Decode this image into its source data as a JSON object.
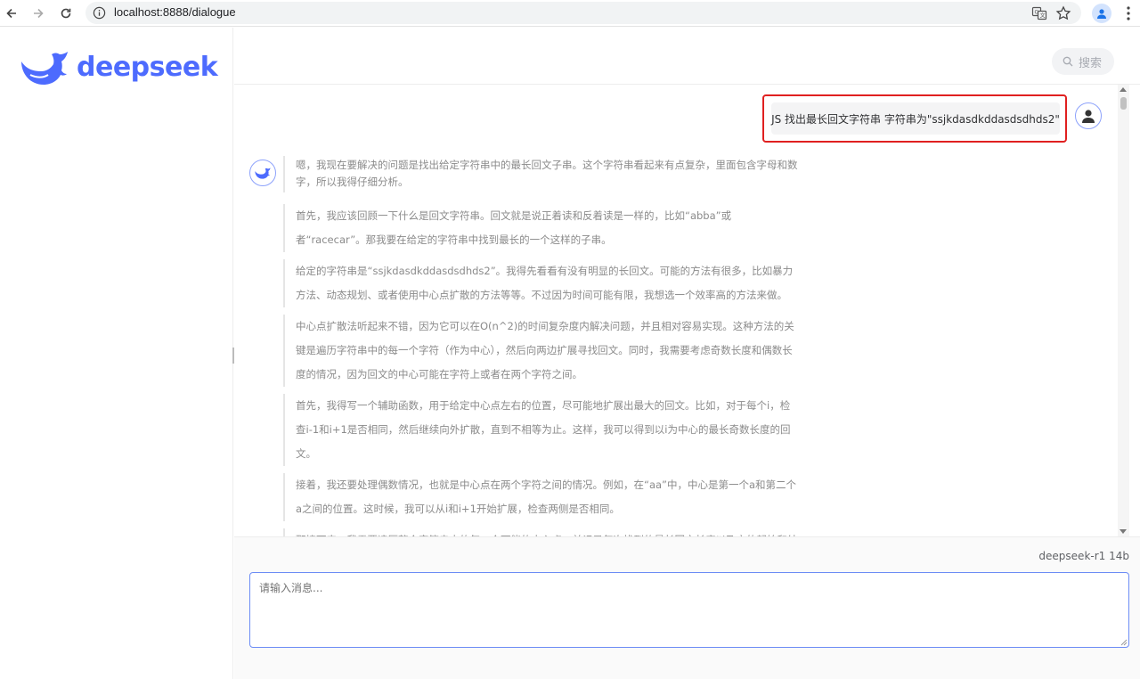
{
  "browser": {
    "url": "localhost:8888/dialogue"
  },
  "sidebar": {
    "logo_text": "deepseek"
  },
  "header": {
    "search_placeholder": "搜索"
  },
  "chat": {
    "user_message": "JS 找出最长回文字符串 字符串为\"ssjkdasdkddasdsdhds2\"",
    "thinking": [
      "嗯，我现在要解决的问题是找出给定字符串中的最长回文子串。这个字符串看起来有点复杂，里面包含字母和数字，所以我得仔细分析。",
      "首先，我应该回顾一下什么是回文字符串。回文就是说正着读和反着读是一样的，比如“abba”或者“racecar”。那我要在给定的字符串中找到最长的一个这样的子串。",
      "给定的字符串是“ssjkdasdkddasdsdhds2”。我得先看看有没有明显的长回文。可能的方法有很多，比如暴力方法、动态规划、或者使用中心点扩散的方法等等。不过因为时间可能有限，我想选一个效率高的方法来做。",
      "中心点扩散法听起来不错，因为它可以在O(n^2)的时间复杂度内解决问题，并且相对容易实现。这种方法的关键是遍历字符串中的每一个字符（作为中心），然后向两边扩展寻找回文。同时，我需要考虑奇数长度和偶数长度的情况，因为回文的中心可能在字符上或者在两个字符之间。",
      "首先，我得写一个辅助函数，用于给定中心点左右的位置，尽可能地扩展出最大的回文。比如，对于每个i，检查i-1和i+1是否相同，然后继续向外扩散，直到不相等为止。这样，我可以得到以i为中心的最长奇数长度的回文。",
      "接着，我还要处理偶数情况，也就是中心点在两个字符之间的情况。例如，在“aa”中，中心是第一个a和第二个a之间的位置。这时候，我可以从i和i+1开始扩展，检查两侧是否相同。",
      "那接下来，我需要遍历整个字符串中的每一个可能的中心点，并记录每次找到的最长回文长度以及它的起始和结束索引。这样，在所有可能的情况中，就能找到最长的那个了。"
    ]
  },
  "footer": {
    "model": "deepseek-r1 14b",
    "input_placeholder": "请输入消息..."
  },
  "colors": {
    "brand": "#4d6bfe",
    "highlight_border": "#e02020"
  }
}
